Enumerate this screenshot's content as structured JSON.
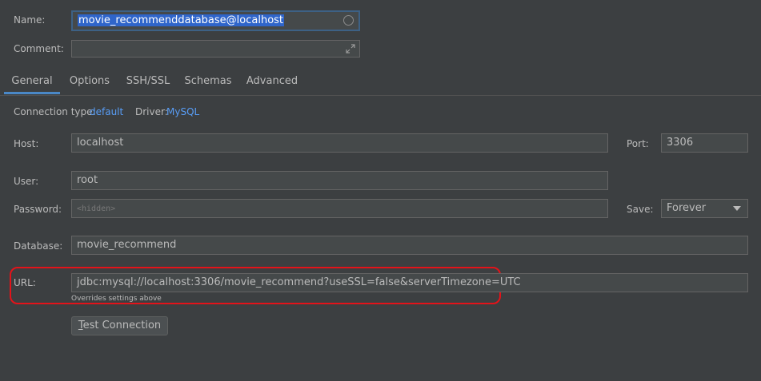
{
  "name": {
    "label": "Name:",
    "value": "movie_recommenddatabase@localhost"
  },
  "comment": {
    "label": "Comment:",
    "value": ""
  },
  "tabs": [
    {
      "label": "General",
      "active": true
    },
    {
      "label": "Options",
      "active": false
    },
    {
      "label": "SSH/SSL",
      "active": false
    },
    {
      "label": "Schemas",
      "active": false
    },
    {
      "label": "Advanced",
      "active": false
    }
  ],
  "connection": {
    "type_label": "Connection type:",
    "type_value": "default",
    "driver_label": "Driver:",
    "driver_value": "MySQL"
  },
  "host": {
    "label": "Host:",
    "value": "localhost"
  },
  "port": {
    "label": "Port:",
    "value": "3306"
  },
  "user": {
    "label": "User:",
    "value": "root"
  },
  "password": {
    "label": "Password:",
    "placeholder": "<hidden>"
  },
  "save": {
    "label": "Save:",
    "value": "Forever"
  },
  "database": {
    "label": "Database:",
    "value": "movie_recommend"
  },
  "url": {
    "label": "URL:",
    "value": "jdbc:mysql://localhost:3306/movie_recommend?useSSL=false&serverTimezone=UTC",
    "note": "Overrides settings above"
  },
  "test_button": {
    "mnemonic": "T",
    "rest": "est Connection"
  },
  "colors": {
    "background": "#3c3f41",
    "field": "#45494a",
    "link": "#589df6",
    "selection": "#2f65ca",
    "highlight": "#e3131a",
    "tab_active": "#4a88c7"
  }
}
